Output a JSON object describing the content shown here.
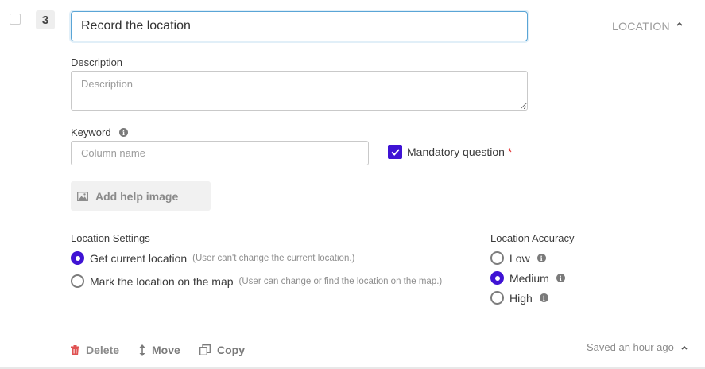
{
  "question": {
    "number": "3",
    "title_value": "Record the location",
    "type_label": "LOCATION"
  },
  "description": {
    "label": "Description",
    "placeholder": "Description"
  },
  "keyword": {
    "label": "Keyword",
    "placeholder": "Column name"
  },
  "mandatory": {
    "label": "Mandatory question",
    "required_marker": "*",
    "checked": true
  },
  "help_image": {
    "label": "Add help image"
  },
  "location_settings": {
    "label": "Location Settings",
    "options": [
      {
        "label": "Get current location",
        "hint": "(User can't change the current location.)",
        "selected": true
      },
      {
        "label": "Mark the location on the map",
        "hint": "(User can change or find the location on the map.)",
        "selected": false
      }
    ]
  },
  "location_accuracy": {
    "label": "Location Accuracy",
    "options": [
      {
        "label": "Low",
        "selected": false
      },
      {
        "label": "Medium",
        "selected": true
      },
      {
        "label": "High",
        "selected": false
      }
    ]
  },
  "footer": {
    "delete_label": "Delete",
    "move_label": "Move",
    "copy_label": "Copy",
    "saved_status": "Saved an hour ago"
  },
  "colors": {
    "accent": "#3f13d4",
    "focus_border": "#5aa5d6",
    "delete_icon": "#e05252",
    "required": "#e02020"
  },
  "icons": [
    "checkbox-icon",
    "chevron-up-icon",
    "info-icon",
    "checkmark-icon",
    "image-icon",
    "trash-icon",
    "move-vertical-icon",
    "copy-icon"
  ]
}
